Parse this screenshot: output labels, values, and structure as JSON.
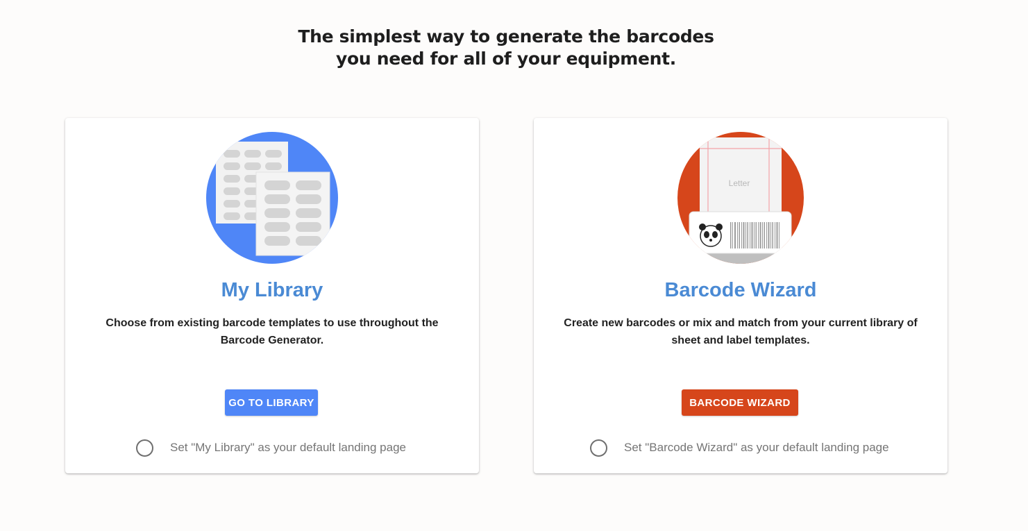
{
  "headline": {
    "line1": "The simplest way to generate the barcodes",
    "line2": "you need for all of your equipment."
  },
  "cards": {
    "library": {
      "icon": "label-sheets-icon",
      "icon_color": "#4f86f7",
      "title": "My Library",
      "description": "Choose from existing barcode templates to use throughout the Barcode Generator.",
      "button_label": "GO TO LIBRARY",
      "button_color": "#4f86f7",
      "default_label": "Set \"My Library\" as your default landing page",
      "default_selected": false
    },
    "wizard": {
      "icon": "barcode-label-printer-icon",
      "icon_color": "#d6461b",
      "sheet_label": "Letter",
      "title": "Barcode Wizard",
      "description": "Create new barcodes or mix and match from your current library of sheet and label templates.",
      "button_label": "BARCODE WIZARD",
      "button_color": "#d6461b",
      "default_label": "Set \"Barcode Wizard\" as your default landing page",
      "default_selected": false
    }
  },
  "colors": {
    "title": "#4a8ad4",
    "background": "#fdfcfb"
  }
}
